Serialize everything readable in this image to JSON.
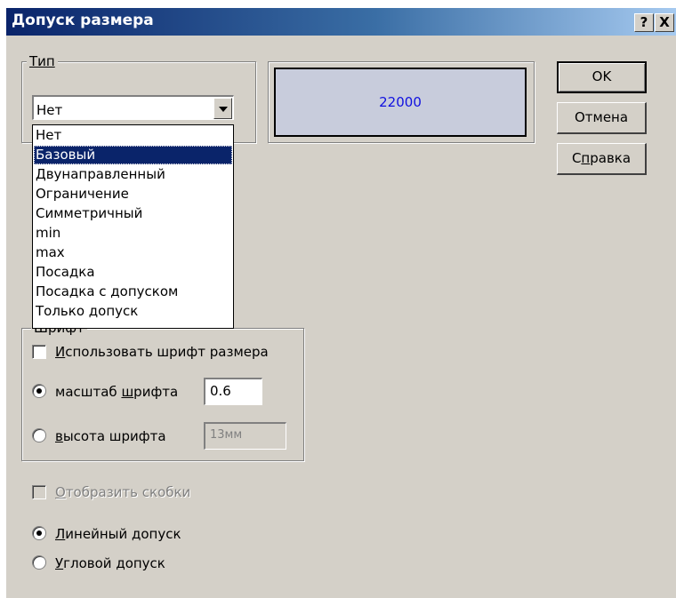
{
  "dialog": {
    "title": "Допуск размера",
    "help_button": "?",
    "close_button": "X"
  },
  "type_group": {
    "label": "Тип",
    "combo_value": "Нет",
    "options": [
      "Нет",
      "Базовый",
      "Двунаправленный",
      "Ограничение",
      "Симметричный",
      "min",
      "max",
      "Посадка",
      "Посадка с допуском",
      "Только допуск"
    ],
    "selected_option": "Базовый"
  },
  "preview": {
    "value": "22000",
    "text_color": "#1010e0",
    "background": "#c8ccdc"
  },
  "buttons": {
    "ok": "OK",
    "cancel": "Отмена",
    "help": "Справка"
  },
  "font_group": {
    "label": "Шрифт",
    "use_dimension_font": {
      "label": "Использовать шрифт размера",
      "checked": false
    },
    "font_scale": {
      "label": "масштаб шрифта",
      "value": "0.6",
      "selected": true
    },
    "font_height": {
      "label": "высота шрифта",
      "value": "13мм",
      "selected": false,
      "enabled": false
    }
  },
  "show_brackets": {
    "label": "Отобразить скобки",
    "checked": false,
    "enabled": false
  },
  "tolerance_kind": {
    "linear": {
      "label": "Линейный допуск",
      "selected": true
    },
    "angular": {
      "label": "Угловой допуск",
      "selected": false
    }
  },
  "colors": {
    "title_start": "#0a246a",
    "title_end": "#a6caf0",
    "face": "#d4d0c8",
    "selection": "#0a246a"
  }
}
